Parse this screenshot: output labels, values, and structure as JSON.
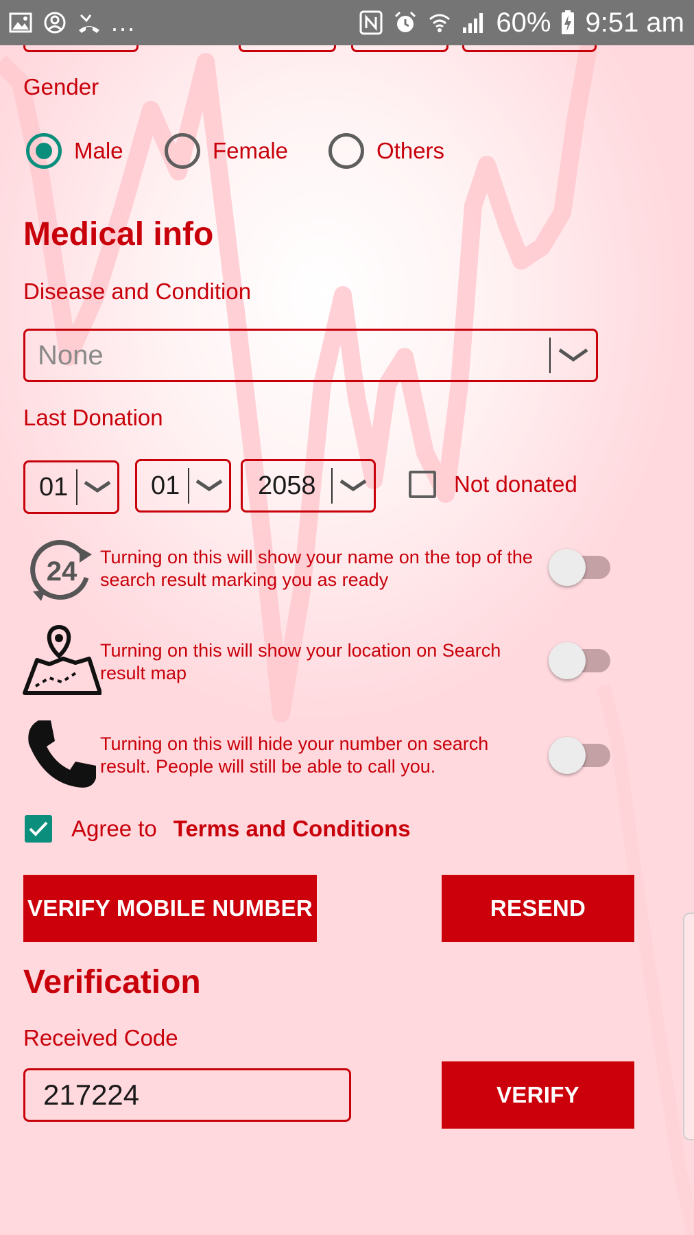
{
  "status_bar": {
    "left_icons": [
      "image-icon",
      "account-circle-icon",
      "missed-call-icon"
    ],
    "overflow": "...",
    "right_icons": [
      "nfc-icon",
      "alarm-icon",
      "wifi-icon",
      "signal-icon"
    ],
    "battery": "60%",
    "time": "9:51 am"
  },
  "gender": {
    "label": "Gender",
    "options": [
      "Male",
      "Female",
      "Others"
    ],
    "selected": "Male"
  },
  "medical": {
    "heading": "Medical info",
    "disease_label": "Disease and Condition",
    "disease_value": "None",
    "last_donation_label": "Last Donation",
    "day": "01",
    "month": "01",
    "year": "2058",
    "not_donated_label": "Not donated",
    "not_donated_checked": false
  },
  "settings": [
    {
      "icon": "24-hours-icon",
      "text": "Turning on this will show your name on the top of the search result marking you as ready",
      "enabled": false
    },
    {
      "icon": "map-pin-icon",
      "text": "Turning on this will show your location on Search result map",
      "enabled": false
    },
    {
      "icon": "phone-icon",
      "text": "Turning on this will hide your number on search result. People will still be able to call you.",
      "enabled": false
    }
  ],
  "terms": {
    "prefix": "Agree to",
    "link": "Terms and Conditions",
    "checked": true
  },
  "buttons": {
    "verify_mobile": "VERIFY MOBILE NUMBER",
    "resend": "RESEND",
    "verify": "VERIFY"
  },
  "verification": {
    "heading": "Verification",
    "code_label": "Received Code",
    "code_value": "217224"
  },
  "colors": {
    "accent": "#c8000a",
    "button": "#cc000a",
    "checked": "#0b8f7c",
    "status_bar": "#757575"
  }
}
